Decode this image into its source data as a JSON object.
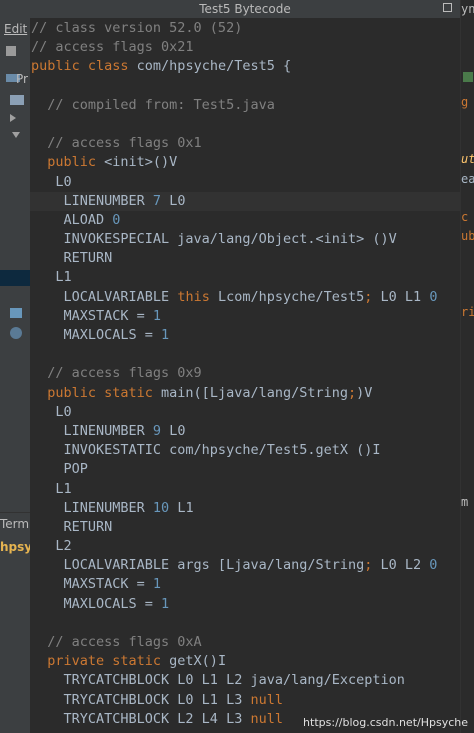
{
  "window": {
    "title": "Test5 Bytecode",
    "maximize_icon": "maximize-icon"
  },
  "background_ide": {
    "menu_edit": "Edit",
    "project_tab": "Pr",
    "terminal_tab": "Termi",
    "package_text": "hpsyc",
    "right_fragments": [
      "yn",
      "g",
      "ut",
      "ea",
      "c",
      "ub",
      "ri",
      "m"
    ]
  },
  "code": [
    [
      [
        "c",
        "// class version 52.0 (52)"
      ]
    ],
    [
      [
        "c",
        "// access flags 0x21"
      ]
    ],
    [
      [
        "k",
        "public class "
      ],
      [
        "t",
        "com/hpsyche/Test5 {"
      ]
    ],
    [],
    [
      [
        "c",
        "  // compiled from: Test5.java"
      ]
    ],
    [],
    [
      [
        "c",
        "  // access flags 0x1"
      ]
    ],
    [
      [
        "k",
        "  public "
      ],
      [
        "t",
        "<init>()V"
      ]
    ],
    [
      [
        "t",
        "   L0"
      ]
    ],
    [
      [
        "t",
        "    LINENUMBER "
      ],
      [
        "n",
        "7"
      ],
      [
        "t",
        " L0"
      ]
    ],
    [
      [
        "t",
        "    ALOAD "
      ],
      [
        "n",
        "0"
      ]
    ],
    [
      [
        "t",
        "    INVOKESPECIAL java/lang/Object.<init> ()V"
      ]
    ],
    [
      [
        "t",
        "    RETURN"
      ]
    ],
    [
      [
        "t",
        "   L1"
      ]
    ],
    [
      [
        "t",
        "    LOCALVARIABLE "
      ],
      [
        "k",
        "this"
      ],
      [
        "t",
        " Lcom/hpsyche/Test5"
      ],
      [
        "p",
        ";"
      ],
      [
        "t",
        " L0 L1 "
      ],
      [
        "n",
        "0"
      ]
    ],
    [
      [
        "t",
        "    MAXSTACK = "
      ],
      [
        "n",
        "1"
      ]
    ],
    [
      [
        "t",
        "    MAXLOCALS = "
      ],
      [
        "n",
        "1"
      ]
    ],
    [],
    [
      [
        "c",
        "  // access flags 0x9"
      ]
    ],
    [
      [
        "k",
        "  public static "
      ],
      [
        "t",
        "main([Ljava/lang/String"
      ],
      [
        "p",
        ";"
      ],
      [
        "t",
        ")V"
      ]
    ],
    [
      [
        "t",
        "   L0"
      ]
    ],
    [
      [
        "t",
        "    LINENUMBER "
      ],
      [
        "n",
        "9"
      ],
      [
        "t",
        " L0"
      ]
    ],
    [
      [
        "t",
        "    INVOKESTATIC com/hpsyche/Test5.getX ()I"
      ]
    ],
    [
      [
        "t",
        "    POP"
      ]
    ],
    [
      [
        "t",
        "   L1"
      ]
    ],
    [
      [
        "t",
        "    LINENUMBER "
      ],
      [
        "n",
        "10"
      ],
      [
        "t",
        " L1"
      ]
    ],
    [
      [
        "t",
        "    RETURN"
      ]
    ],
    [
      [
        "t",
        "   L2"
      ]
    ],
    [
      [
        "t",
        "    LOCALVARIABLE args [Ljava/lang/String"
      ],
      [
        "p",
        ";"
      ],
      [
        "t",
        " L0 L2 "
      ],
      [
        "n",
        "0"
      ]
    ],
    [
      [
        "t",
        "    MAXSTACK = "
      ],
      [
        "n",
        "1"
      ]
    ],
    [
      [
        "t",
        "    MAXLOCALS = "
      ],
      [
        "n",
        "1"
      ]
    ],
    [],
    [
      [
        "c",
        "  // access flags 0xA"
      ]
    ],
    [
      [
        "k",
        "  private static "
      ],
      [
        "t",
        "getX()I"
      ]
    ],
    [
      [
        "t",
        "    TRYCATCHBLOCK L0 L1 L2 java/lang/Exception"
      ]
    ],
    [
      [
        "t",
        "    TRYCATCHBLOCK L0 L1 L3 "
      ],
      [
        "k",
        "null"
      ]
    ],
    [
      [
        "t",
        "    TRYCATCHBLOCK L2 L4 L3 "
      ],
      [
        "k",
        "null"
      ]
    ]
  ],
  "highlighted_line": 9,
  "watermark": "https://blog.csdn.net/Hpsyche"
}
